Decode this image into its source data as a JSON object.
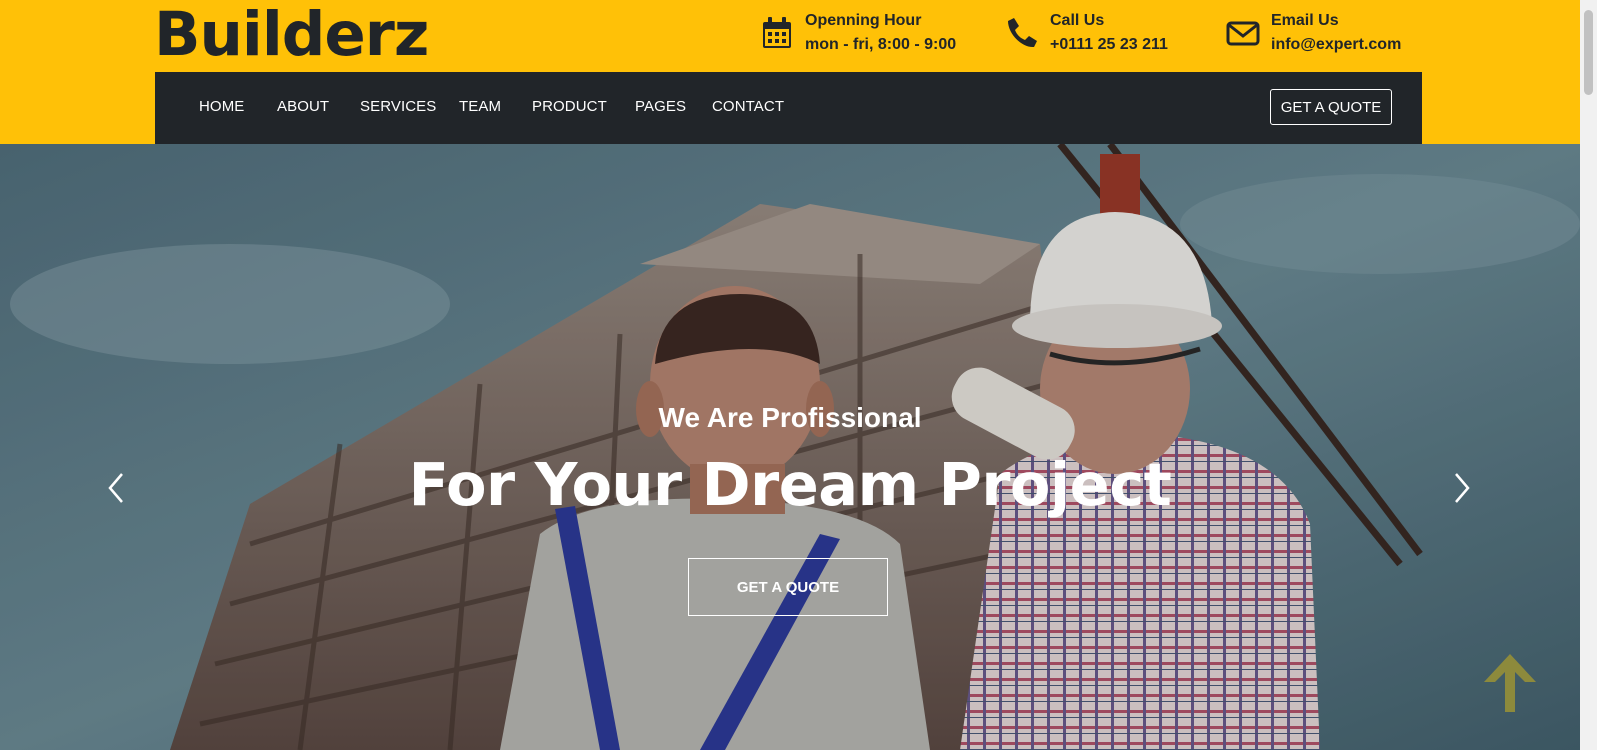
{
  "brand": {
    "name": "Builderz"
  },
  "contact": [
    {
      "icon": "calendar-icon",
      "label": "Openning Hour",
      "value": "mon - fri, 8:00 - 9:00"
    },
    {
      "icon": "phone-icon",
      "label": "Call Us",
      "value": "+0111 25 23 211"
    },
    {
      "icon": "envelope-icon",
      "label": "Email Us",
      "value": "info@expert.com"
    }
  ],
  "nav": {
    "items": [
      "HOME",
      "ABOUT",
      "SERVICES",
      "TEAM",
      "PRODUCT",
      "PAGES",
      "CONTACT"
    ],
    "cta": "GET A QUOTE"
  },
  "hero": {
    "subtitle": "We Are Profissional",
    "title": "For Your Dream Project",
    "button": "GET A QUOTE",
    "prev_icon": "chevron-left-icon",
    "next_icon": "chevron-right-icon"
  },
  "back_to_top": {
    "icon": "arrow-up-icon"
  },
  "colors": {
    "accent": "#ffc107",
    "navbar": "#212529",
    "text_dark": "#212529",
    "white": "#ffffff",
    "back_to_top": "#8d8a3c"
  }
}
